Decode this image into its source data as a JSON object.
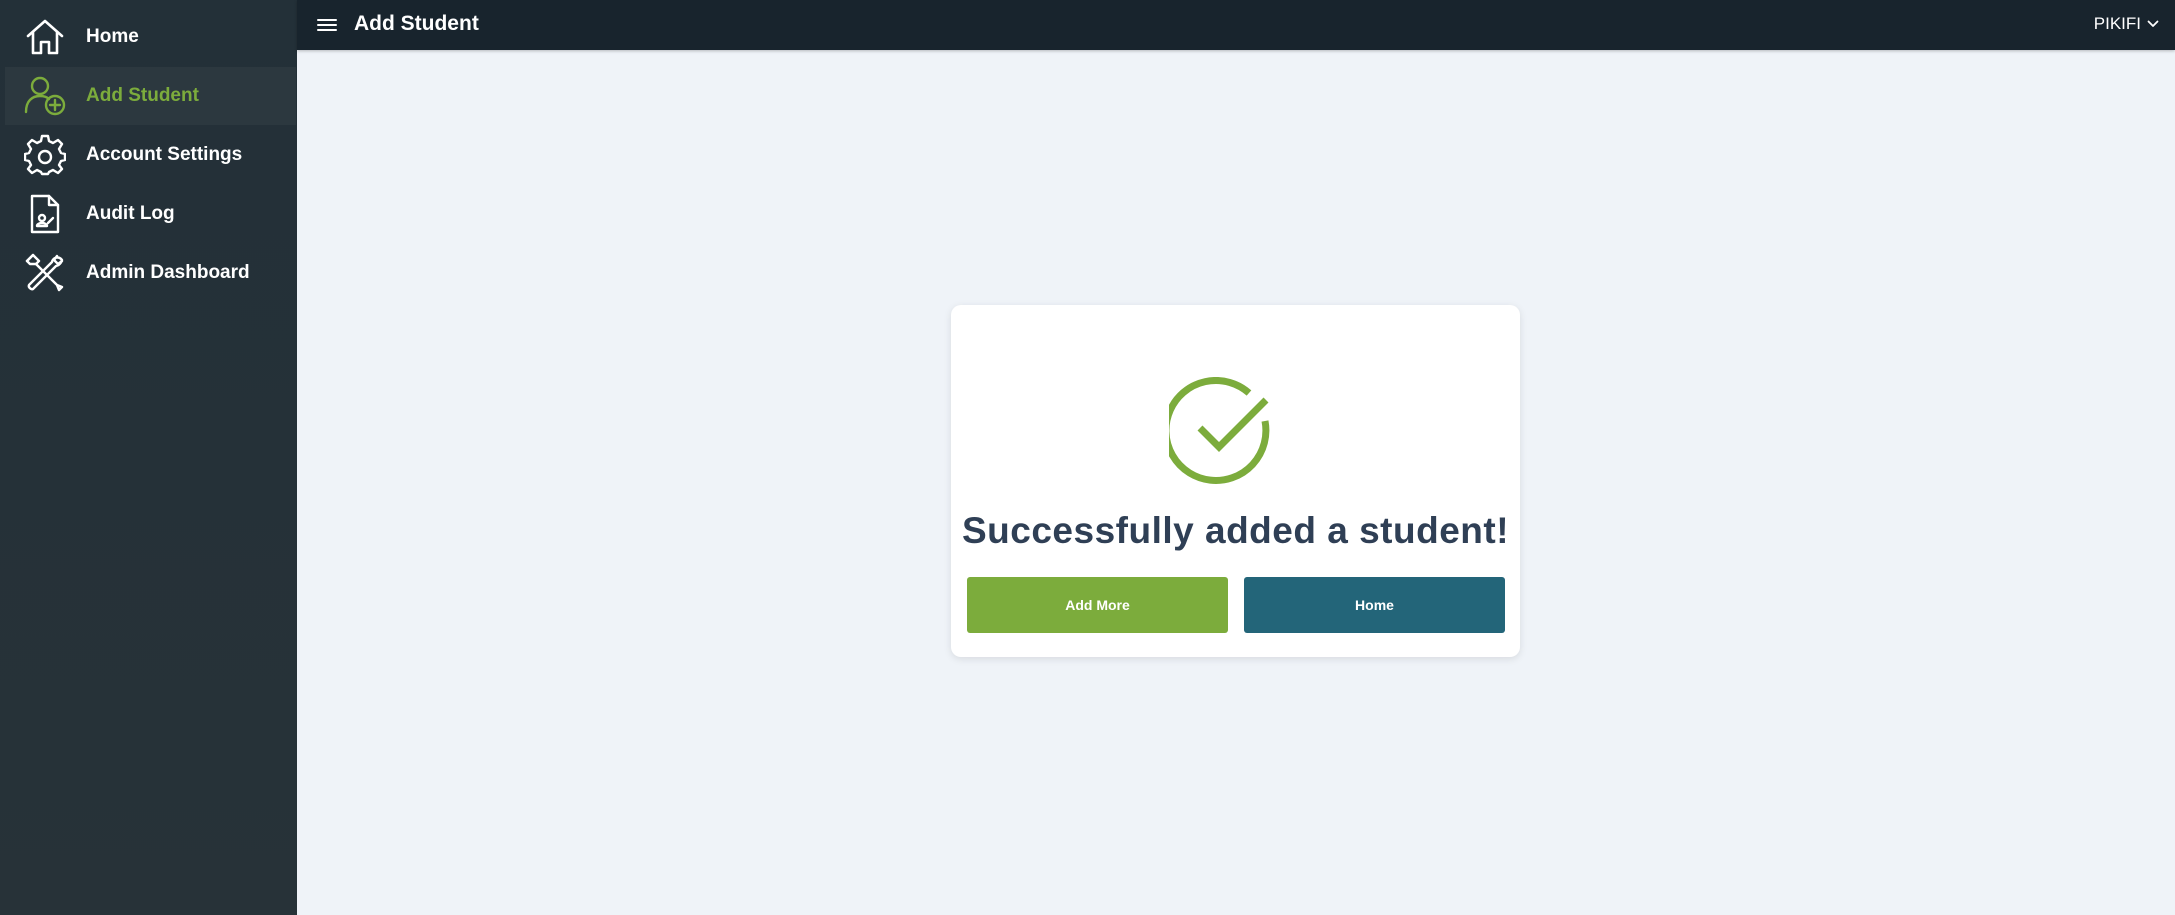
{
  "sidebar": {
    "items": [
      {
        "label": "Home",
        "icon": "home-icon"
      },
      {
        "label": "Add Student",
        "icon": "add-user-icon",
        "active": true
      },
      {
        "label": "Account Settings",
        "icon": "gear-icon"
      },
      {
        "label": "Audit Log",
        "icon": "document-icon"
      },
      {
        "label": "Admin Dashboard",
        "icon": "tools-icon"
      }
    ]
  },
  "header": {
    "title": "Add Student",
    "menu_icon": "hamburger-icon",
    "user": "PIKIFI",
    "user_icon": "chevron-down-icon"
  },
  "card": {
    "icon": "check-circle-icon",
    "message": "Successfully added a student!",
    "add_more_label": "Add More",
    "home_label": "Home"
  },
  "colors": {
    "accent": "#7cac3c",
    "secondary": "#236579",
    "sidebar": "#273238",
    "topbar": "#18242d",
    "background": "#eff3f8",
    "heading": "#2f3f55"
  }
}
